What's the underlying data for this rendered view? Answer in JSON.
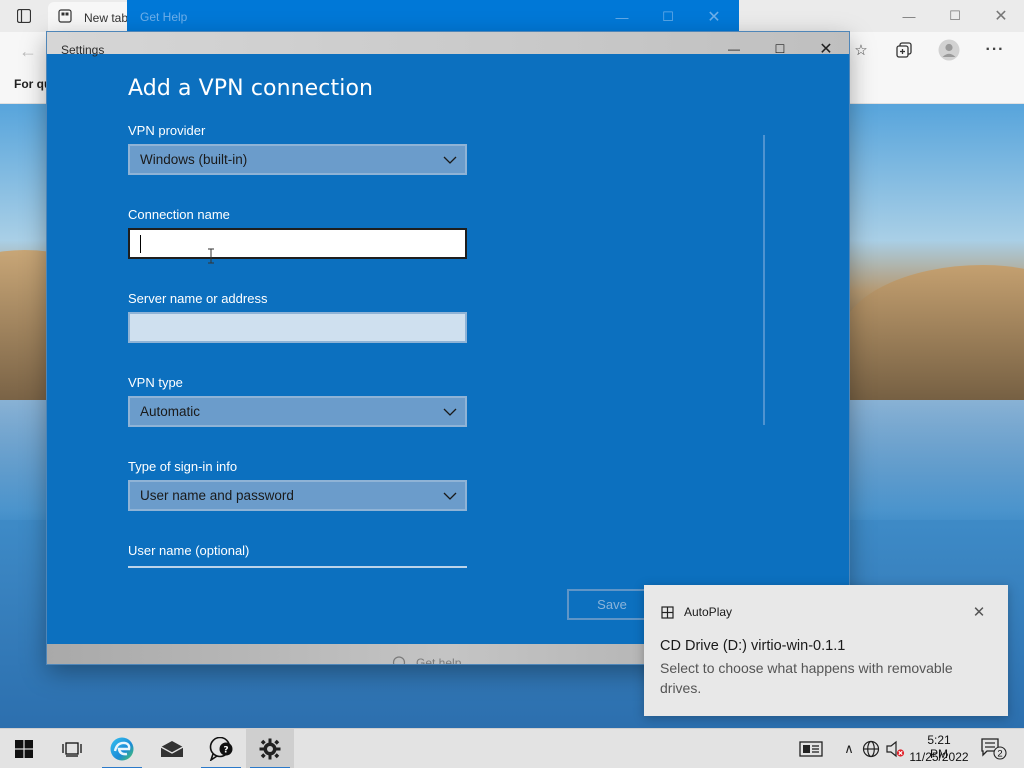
{
  "browser": {
    "tab_label": "New tab",
    "favbar_text": "For qu",
    "min_glyph": "—",
    "max_glyph": "☐",
    "close_glyph": "✕",
    "back_glyph": "←",
    "fav_glyph": "☆",
    "more_glyph": "···"
  },
  "gethelp_window": {
    "title": "Get Help",
    "min_glyph": "—",
    "max_glyph": "☐",
    "close_glyph": "✕"
  },
  "settings_window": {
    "title": "Settings",
    "min_glyph": "—",
    "max_glyph": "☐",
    "close_glyph": "✕",
    "get_help_ghost": "Get help"
  },
  "vpn_form": {
    "heading": "Add a VPN connection",
    "provider": {
      "label": "VPN provider",
      "value": "Windows (built-in)"
    },
    "connection_name": {
      "label": "Connection name",
      "value": ""
    },
    "server": {
      "label": "Server name or address",
      "value": ""
    },
    "vpn_type": {
      "label": "VPN type",
      "value": "Automatic"
    },
    "signin_type": {
      "label": "Type of sign-in info",
      "value": "User name and password"
    },
    "username": {
      "label": "User name (optional)"
    },
    "save_label": "Save"
  },
  "toast": {
    "app_name": "AutoPlay",
    "close_glyph": "✕",
    "title": "CD Drive (D:) virtio-win-0.1.1",
    "body": "Select to choose what happens with removable drives."
  },
  "taskbar": {
    "time": "5:21 PM",
    "date": "11/25/2022",
    "notification_count": "2",
    "tray_chevron": "∧"
  },
  "colors": {
    "settings_bg": "#0c70bf",
    "accent": "#0078d7",
    "dropdown_bg": "#6b9ccb"
  }
}
